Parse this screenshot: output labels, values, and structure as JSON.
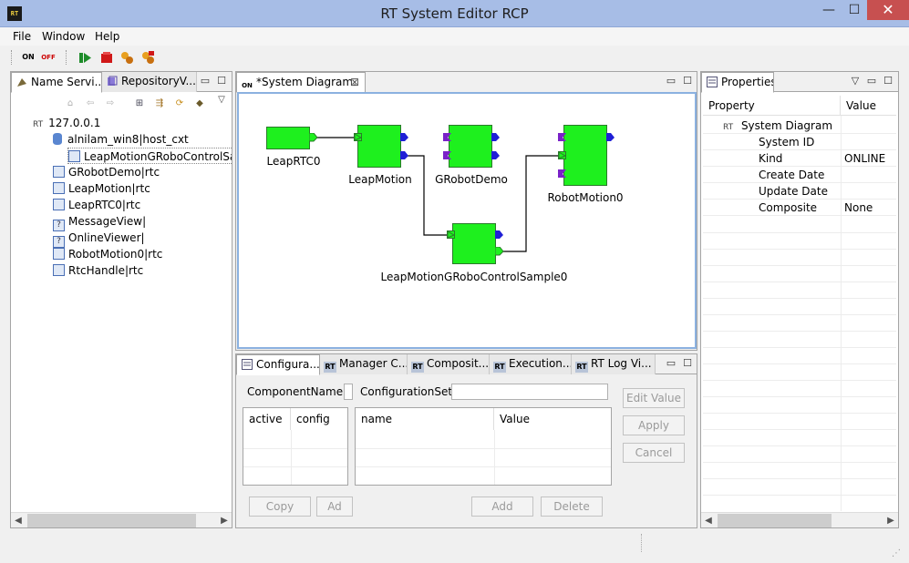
{
  "window": {
    "title": "RT System Editor RCP",
    "app_icon": "RT",
    "min_glyph": "—",
    "max_glyph": "☐",
    "close_glyph": "✕"
  },
  "menu": [
    "File",
    "Window",
    "Help"
  ],
  "toolbar": {
    "on_label": "ON",
    "off_label": "OFF"
  },
  "name_service": {
    "tabs": [
      "Name Servi...",
      "RepositoryV..."
    ],
    "root": "127.0.0.1",
    "root_badge": "RT",
    "host": "alnilam_win8|host_cxt",
    "items": [
      "LeapMotionGRoboControlSan",
      "GRobotDemo|rtc",
      "LeapMotion|rtc",
      "LeapRTC0|rtc",
      "MessageView|",
      "OnlineViewer|",
      "RobotMotion0|rtc",
      "RtcHandle|rtc"
    ],
    "unknown_badge": "?"
  },
  "diagram": {
    "tab_title": "*System Diagram.",
    "tab_icon_text": "ON",
    "close_glyph": "⊠",
    "components": {
      "leaprtc0": "LeapRTC0",
      "leapmotion": "LeapMotion",
      "grobotdemo": "GRobotDemo",
      "robotmotion0": "RobotMotion0",
      "sample": "LeapMotionGRoboControlSample0"
    },
    "colors": {
      "component": "#1ef01e",
      "inport": "#7a22c8",
      "outport": "#1f1fd6",
      "wire": "#000000"
    }
  },
  "properties": {
    "tab_title": "Properties",
    "col_property": "Property",
    "col_value": "Value",
    "root_badge": "RT",
    "root_label": "System Diagram",
    "rows": [
      {
        "name": "System ID",
        "value": ""
      },
      {
        "name": "Kind",
        "value": "ONLINE"
      },
      {
        "name": "Create Date",
        "value": ""
      },
      {
        "name": "Update Date",
        "value": ""
      },
      {
        "name": "Composite",
        "value": "None"
      }
    ]
  },
  "bottom_tabs": {
    "badge": "RT",
    "labels": [
      "Configura...",
      "Manager C...",
      "Composit...",
      "Execution...",
      "RT Log Vi..."
    ]
  },
  "config": {
    "component_name_label": "ComponentName :",
    "configuration_set_label": "ConfigurationSet :",
    "left_cols": [
      "active",
      "config"
    ],
    "right_cols": [
      "name",
      "Value"
    ],
    "edit_value": "Edit Value",
    "apply": "Apply",
    "cancel": "Cancel",
    "copy": "Copy",
    "add_left": "Ad",
    "add": "Add",
    "delete": "Delete"
  }
}
